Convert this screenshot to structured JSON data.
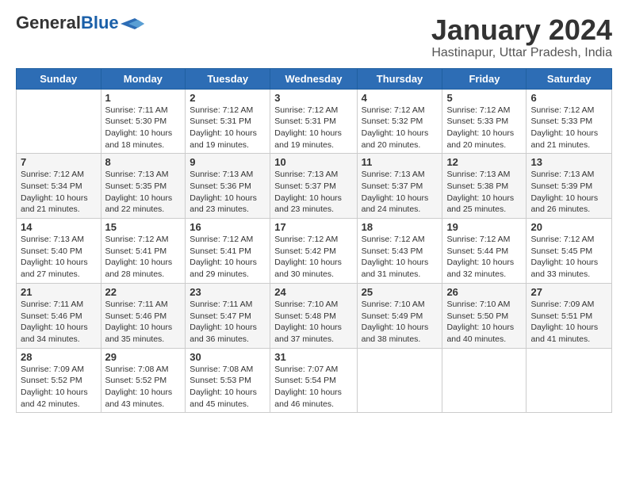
{
  "header": {
    "logo_general": "General",
    "logo_blue": "Blue",
    "title": "January 2024",
    "subtitle": "Hastinapur, Uttar Pradesh, India"
  },
  "weekdays": [
    "Sunday",
    "Monday",
    "Tuesday",
    "Wednesday",
    "Thursday",
    "Friday",
    "Saturday"
  ],
  "weeks": [
    [
      {
        "day": "",
        "info": ""
      },
      {
        "day": "1",
        "info": "Sunrise: 7:11 AM\nSunset: 5:30 PM\nDaylight: 10 hours\nand 18 minutes."
      },
      {
        "day": "2",
        "info": "Sunrise: 7:12 AM\nSunset: 5:31 PM\nDaylight: 10 hours\nand 19 minutes."
      },
      {
        "day": "3",
        "info": "Sunrise: 7:12 AM\nSunset: 5:31 PM\nDaylight: 10 hours\nand 19 minutes."
      },
      {
        "day": "4",
        "info": "Sunrise: 7:12 AM\nSunset: 5:32 PM\nDaylight: 10 hours\nand 20 minutes."
      },
      {
        "day": "5",
        "info": "Sunrise: 7:12 AM\nSunset: 5:33 PM\nDaylight: 10 hours\nand 20 minutes."
      },
      {
        "day": "6",
        "info": "Sunrise: 7:12 AM\nSunset: 5:33 PM\nDaylight: 10 hours\nand 21 minutes."
      }
    ],
    [
      {
        "day": "7",
        "info": "Sunrise: 7:12 AM\nSunset: 5:34 PM\nDaylight: 10 hours\nand 21 minutes."
      },
      {
        "day": "8",
        "info": "Sunrise: 7:13 AM\nSunset: 5:35 PM\nDaylight: 10 hours\nand 22 minutes."
      },
      {
        "day": "9",
        "info": "Sunrise: 7:13 AM\nSunset: 5:36 PM\nDaylight: 10 hours\nand 23 minutes."
      },
      {
        "day": "10",
        "info": "Sunrise: 7:13 AM\nSunset: 5:37 PM\nDaylight: 10 hours\nand 23 minutes."
      },
      {
        "day": "11",
        "info": "Sunrise: 7:13 AM\nSunset: 5:37 PM\nDaylight: 10 hours\nand 24 minutes."
      },
      {
        "day": "12",
        "info": "Sunrise: 7:13 AM\nSunset: 5:38 PM\nDaylight: 10 hours\nand 25 minutes."
      },
      {
        "day": "13",
        "info": "Sunrise: 7:13 AM\nSunset: 5:39 PM\nDaylight: 10 hours\nand 26 minutes."
      }
    ],
    [
      {
        "day": "14",
        "info": "Sunrise: 7:13 AM\nSunset: 5:40 PM\nDaylight: 10 hours\nand 27 minutes."
      },
      {
        "day": "15",
        "info": "Sunrise: 7:12 AM\nSunset: 5:41 PM\nDaylight: 10 hours\nand 28 minutes."
      },
      {
        "day": "16",
        "info": "Sunrise: 7:12 AM\nSunset: 5:41 PM\nDaylight: 10 hours\nand 29 minutes."
      },
      {
        "day": "17",
        "info": "Sunrise: 7:12 AM\nSunset: 5:42 PM\nDaylight: 10 hours\nand 30 minutes."
      },
      {
        "day": "18",
        "info": "Sunrise: 7:12 AM\nSunset: 5:43 PM\nDaylight: 10 hours\nand 31 minutes."
      },
      {
        "day": "19",
        "info": "Sunrise: 7:12 AM\nSunset: 5:44 PM\nDaylight: 10 hours\nand 32 minutes."
      },
      {
        "day": "20",
        "info": "Sunrise: 7:12 AM\nSunset: 5:45 PM\nDaylight: 10 hours\nand 33 minutes."
      }
    ],
    [
      {
        "day": "21",
        "info": "Sunrise: 7:11 AM\nSunset: 5:46 PM\nDaylight: 10 hours\nand 34 minutes."
      },
      {
        "day": "22",
        "info": "Sunrise: 7:11 AM\nSunset: 5:46 PM\nDaylight: 10 hours\nand 35 minutes."
      },
      {
        "day": "23",
        "info": "Sunrise: 7:11 AM\nSunset: 5:47 PM\nDaylight: 10 hours\nand 36 minutes."
      },
      {
        "day": "24",
        "info": "Sunrise: 7:10 AM\nSunset: 5:48 PM\nDaylight: 10 hours\nand 37 minutes."
      },
      {
        "day": "25",
        "info": "Sunrise: 7:10 AM\nSunset: 5:49 PM\nDaylight: 10 hours\nand 38 minutes."
      },
      {
        "day": "26",
        "info": "Sunrise: 7:10 AM\nSunset: 5:50 PM\nDaylight: 10 hours\nand 40 minutes."
      },
      {
        "day": "27",
        "info": "Sunrise: 7:09 AM\nSunset: 5:51 PM\nDaylight: 10 hours\nand 41 minutes."
      }
    ],
    [
      {
        "day": "28",
        "info": "Sunrise: 7:09 AM\nSunset: 5:52 PM\nDaylight: 10 hours\nand 42 minutes."
      },
      {
        "day": "29",
        "info": "Sunrise: 7:08 AM\nSunset: 5:52 PM\nDaylight: 10 hours\nand 43 minutes."
      },
      {
        "day": "30",
        "info": "Sunrise: 7:08 AM\nSunset: 5:53 PM\nDaylight: 10 hours\nand 45 minutes."
      },
      {
        "day": "31",
        "info": "Sunrise: 7:07 AM\nSunset: 5:54 PM\nDaylight: 10 hours\nand 46 minutes."
      },
      {
        "day": "",
        "info": ""
      },
      {
        "day": "",
        "info": ""
      },
      {
        "day": "",
        "info": ""
      }
    ]
  ]
}
